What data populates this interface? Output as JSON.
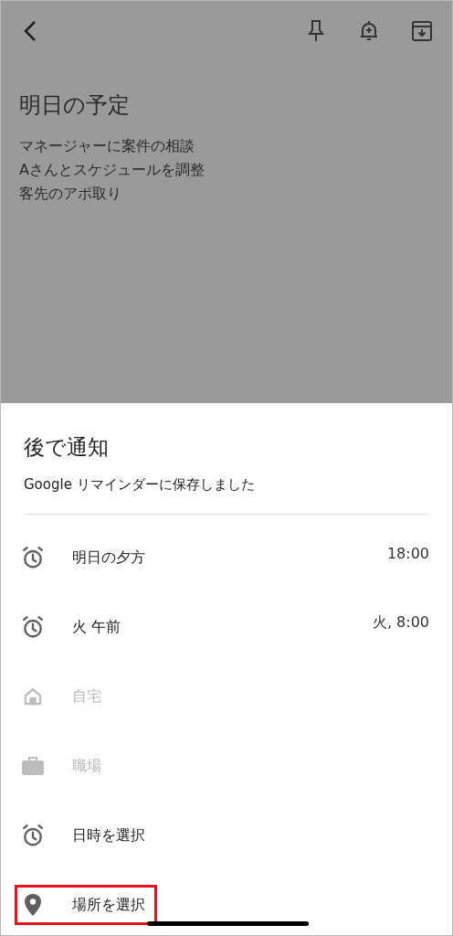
{
  "note": {
    "title": "明日の予定",
    "lines": [
      "マネージャーに案件の相談",
      "Aさんとスケジュールを調整",
      "客先のアポ取り"
    ]
  },
  "sheet": {
    "title": "後で通知",
    "subtitle": "Google リマインダーに保存しました",
    "items": [
      {
        "kind": "alarm",
        "label": "明日の夕方",
        "time": "18:00",
        "disabled": false,
        "highlighted": false
      },
      {
        "kind": "alarm",
        "label": "火 午前",
        "time": "火, 8:00",
        "disabled": false,
        "highlighted": false
      },
      {
        "kind": "home",
        "label": "自宅",
        "disabled": true,
        "highlighted": false
      },
      {
        "kind": "work",
        "label": "職場",
        "disabled": true,
        "highlighted": false
      },
      {
        "kind": "alarm",
        "label": "日時を選択",
        "disabled": false,
        "highlighted": false
      },
      {
        "kind": "location",
        "label": "場所を選択",
        "disabled": false,
        "highlighted": true
      }
    ]
  }
}
